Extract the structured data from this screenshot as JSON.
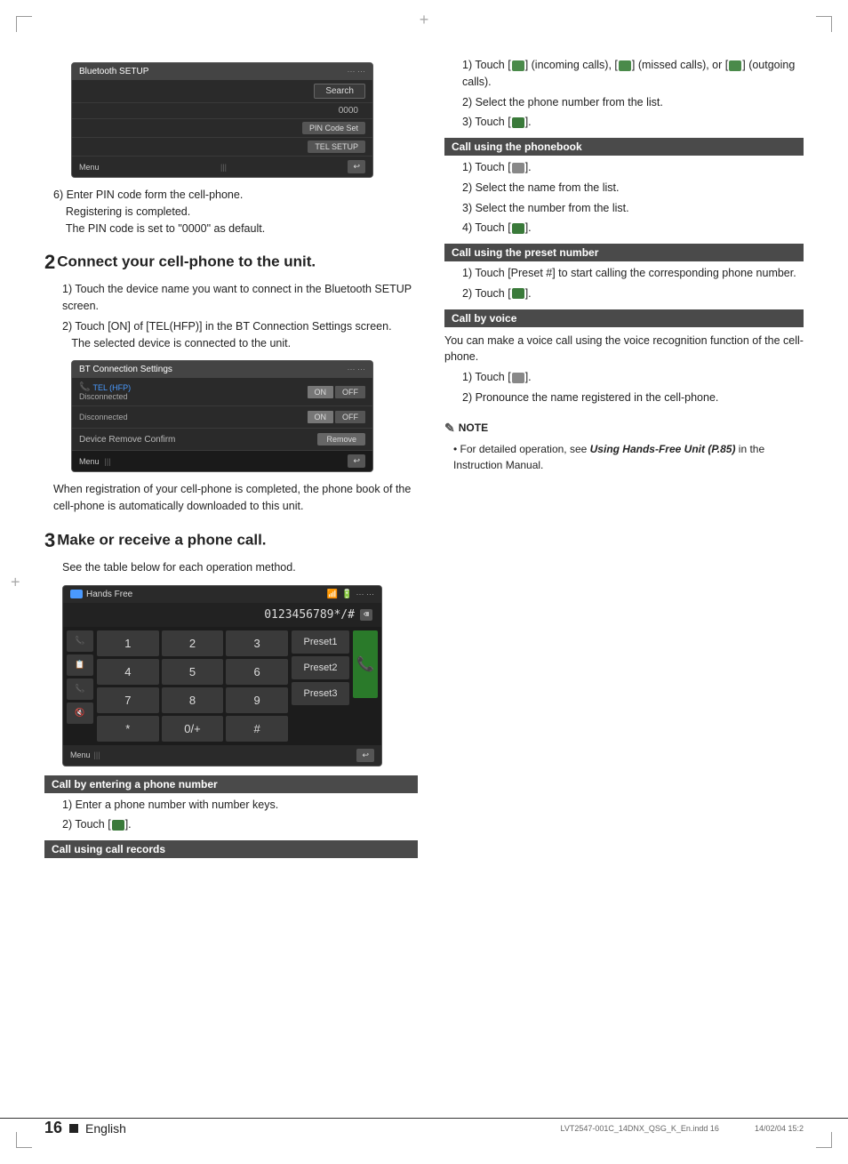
{
  "page": {
    "number": "16",
    "language": "English",
    "filename": "LVT2547-001C_14DNX_QSG_K_En.indd   16",
    "date": "14/02/04   15:2"
  },
  "section2": {
    "heading": "Connect your cell-phone to the unit.",
    "step_number": "2",
    "steps": [
      "Touch the device name you want to connect in the Bluetooth SETUP screen.",
      "Touch [ON] of [TEL(HFP)] in the BT Connection Settings screen. The selected device is connected to the unit."
    ],
    "after_text": "When registration of your cell-phone is completed, the phone book of the cell-phone is automatically downloaded to this unit."
  },
  "section3": {
    "heading": "Make or receive a phone call.",
    "step_number": "3",
    "intro": "See the table below for each operation method."
  },
  "call_sections": {
    "call_by_number": {
      "header": "Call by entering a phone number",
      "steps": [
        "Enter a phone number with number keys.",
        "Touch [   ]."
      ]
    },
    "call_using_records": {
      "header": "Call using call records",
      "steps": [
        "Touch [   ] (incoming calls), [   ] (missed calls), or [   ] (outgoing calls).",
        "Select the phone number from the list.",
        "Touch [   ]."
      ]
    },
    "call_using_phonebook": {
      "header": "Call using the phonebook",
      "steps": [
        "Touch [   ].",
        "Select the name from the list.",
        "Select the number from the list.",
        "Touch [   ]."
      ]
    },
    "call_using_preset": {
      "header": "Call using the preset number",
      "steps": [
        "Touch [Preset #] to start calling the corresponding phone number.",
        "Touch [   ]."
      ]
    },
    "call_by_voice": {
      "header": "Call by voice",
      "intro": "You can make a voice call using the voice recognition function of the cell-phone.",
      "steps": [
        "Touch [   ].",
        "Pronounce the name registered in the cell-phone."
      ]
    }
  },
  "note": {
    "header": "NOTE",
    "items": [
      "For detailed operation, see Using Hands-Free Unit (P.85) in the Instruction Manual."
    ]
  },
  "bt_setup_screen": {
    "title": "Bluetooth SETUP",
    "search_btn": "Search",
    "row1_value": "0000",
    "row2_btn": "PIN Code Set",
    "row3_btn": "TEL SETUP",
    "menu": "Menu"
  },
  "bt_connection_screen": {
    "title": "BT Connection Settings",
    "row1_label": "TEL (HFP)",
    "row1_status": "Disconnected",
    "row1_on": "ON",
    "row1_off": "OFF",
    "row2_status": "Disconnected",
    "row2_on": "ON",
    "row2_off": "OFF",
    "row3_label": "Device Remove Confirm",
    "row3_btn": "Remove",
    "menu": "Menu"
  },
  "hf_screen": {
    "title": "Hands Free",
    "number": "0123456789*/#",
    "keys": [
      "1",
      "2",
      "3",
      "4",
      "5",
      "6",
      "7",
      "8",
      "9",
      "*",
      "0/+",
      "#"
    ],
    "presets": [
      "Preset1",
      "Preset2",
      "Preset3"
    ],
    "menu": "Menu"
  }
}
